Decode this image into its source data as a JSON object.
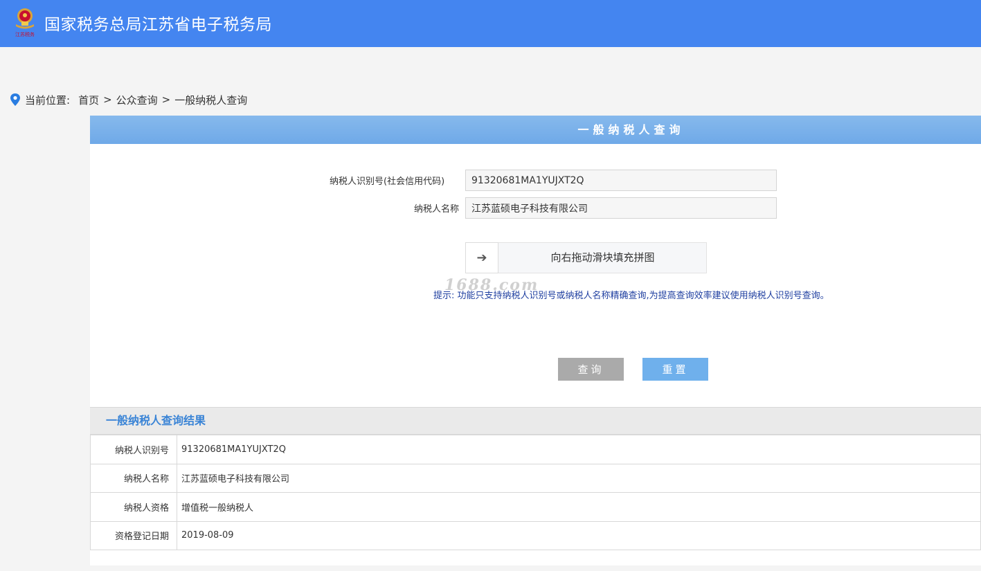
{
  "header": {
    "site_title": "国家税务总局江苏省电子税务局",
    "logo_caption": "江苏税务"
  },
  "breadcrumb": {
    "label": "当前位置:",
    "items": [
      "首页",
      "公众查询",
      "一般纳税人查询"
    ],
    "separator": ">"
  },
  "panel": {
    "title": "一般纳税人查询"
  },
  "form": {
    "taxpayer_id_label": "纳税人识别号(社会信用代码)",
    "taxpayer_id_value": "91320681MA1YUJXT2Q",
    "taxpayer_name_label": "纳税人名称",
    "taxpayer_name_value": "江苏蓝硕电子科技有限公司"
  },
  "slider": {
    "handle_icon": "arrow-right-icon",
    "handle_glyph": "➔",
    "text": "向右拖动滑块填充拼图"
  },
  "hint": "提示: 功能只支持纳税人识别号或纳税人名称精确查询,为提高查询效率建议使用纳税人识别号查询。",
  "watermark": "1688.com",
  "buttons": {
    "query": "查询",
    "reset": "重置"
  },
  "result": {
    "title": "一般纳税人查询结果",
    "rows": [
      {
        "key": "纳税人识别号",
        "value": "91320681MA1YUJXT2Q"
      },
      {
        "key": "纳税人名称",
        "value": "江苏蓝硕电子科技有限公司"
      },
      {
        "key": "纳税人资格",
        "value": "增值税一般纳税人"
      },
      {
        "key": "资格登记日期",
        "value": "2019-08-09"
      }
    ]
  },
  "colors": {
    "topbar": "#4485f0",
    "panel_header": "#6fa9e8",
    "result_title": "#3a84d6",
    "hint": "#1f3fa0",
    "query_button": "#aaaaaa",
    "reset_button": "#6fb0ec"
  }
}
